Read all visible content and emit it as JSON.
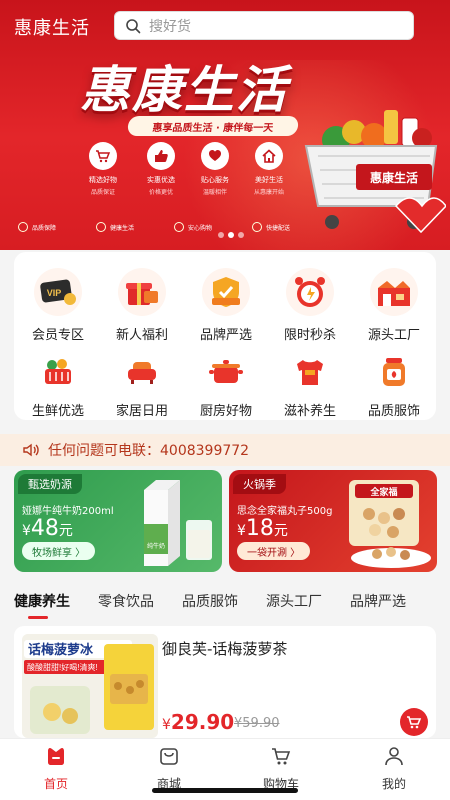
{
  "header": {
    "app_name": "惠康生活",
    "search_placeholder": "搜好货"
  },
  "banner": {
    "title": "惠康生活",
    "slogan": "惠享品质生活 · 康伴每一天",
    "features": [
      {
        "title": "精选好物",
        "sub": "品质保证",
        "icon": "cart-icon"
      },
      {
        "title": "实惠优选",
        "sub": "价格更优",
        "icon": "thumb-up-icon"
      },
      {
        "title": "贴心服务",
        "sub": "温暖相伴",
        "icon": "heart-hand-icon"
      },
      {
        "title": "美好生活",
        "sub": "从惠康开始",
        "icon": "house-icon"
      }
    ],
    "strip": [
      "品质保障",
      "健康生活",
      "安心购物",
      "快捷配送"
    ],
    "cart_label": "惠康生活",
    "slide_count": 3,
    "active_slide": 1
  },
  "menu": [
    {
      "label": "会员专区",
      "icon": "vip-card-icon"
    },
    {
      "label": "新人福利",
      "icon": "gift-box-icon"
    },
    {
      "label": "品牌严选",
      "icon": "brand-badge-icon"
    },
    {
      "label": "限时秒杀",
      "icon": "alarm-clock-icon"
    },
    {
      "label": "源头工厂",
      "icon": "factory-icon"
    },
    {
      "label": "生鲜优选",
      "icon": "fruit-basket-icon"
    },
    {
      "label": "家居日用",
      "icon": "sofa-icon"
    },
    {
      "label": "厨房好物",
      "icon": "pot-icon"
    },
    {
      "label": "滋补养生",
      "icon": "shirt-icon"
    },
    {
      "label": "品质服饰",
      "icon": "jar-icon"
    }
  ],
  "notice": {
    "text": "任何问题可电联：4008399772",
    "icon": "speaker-icon"
  },
  "promos": [
    {
      "tag": "甄选奶源",
      "desc": "娅娜牛纯牛奶200ml",
      "currency": "¥",
      "price": "48",
      "unit": "元",
      "button": "牧场鲜享 〉",
      "box_label": "纯牛奶",
      "accent": "#2f9c4d"
    },
    {
      "tag": "火锅季",
      "desc": "思念全家福丸子500g",
      "currency": "¥",
      "price": "18",
      "unit": "元",
      "button": "一袋开涮 〉",
      "box_label": "全家福",
      "accent": "#c4161c"
    }
  ],
  "tabs": [
    {
      "label": "健康养生",
      "active": true
    },
    {
      "label": "零食饮品",
      "active": false
    },
    {
      "label": "品质服饰",
      "active": false
    },
    {
      "label": "源头工厂",
      "active": false
    },
    {
      "label": "品牌严选",
      "active": false
    }
  ],
  "product": {
    "name": "御良芙-话梅菠萝茶",
    "currency": "¥",
    "price": "29.90",
    "old_price": "¥59.90",
    "image_text1": "话梅菠萝冰",
    "image_text2": "酸酸甜甜!好喝!清爽!"
  },
  "bottom_nav": [
    {
      "label": "首页",
      "icon": "home-icon",
      "active": true
    },
    {
      "label": "商城",
      "icon": "shop-bag-icon",
      "active": false
    },
    {
      "label": "购物车",
      "icon": "cart-icon",
      "active": false
    },
    {
      "label": "我的",
      "icon": "user-icon",
      "active": false
    }
  ],
  "colors": {
    "primary": "#e3262a",
    "notice_bg": "#fbeee2",
    "notice_text": "#b4361c"
  }
}
